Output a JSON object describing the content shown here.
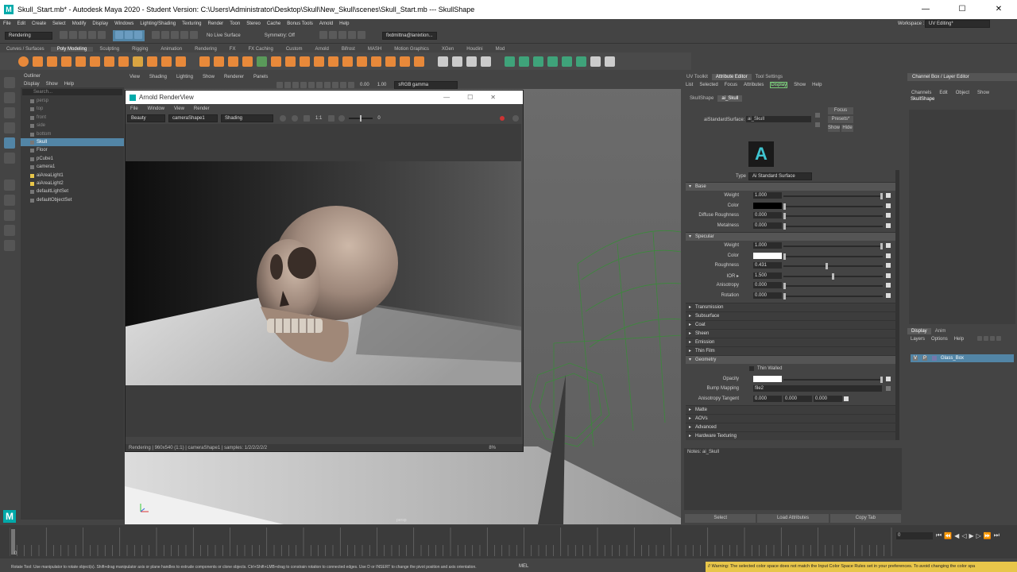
{
  "window": {
    "title": "Skull_Start.mb* - Autodesk Maya 2020 - Student Version: C:\\Users\\Administrator\\Desktop\\Skull\\New_Skull\\scenes\\Skull_Start.mb  ---  SkullShape",
    "logo": "M",
    "minimize": "—",
    "maximize": "☐",
    "close": "✕"
  },
  "menubar": {
    "items": [
      "File",
      "Edit",
      "Create",
      "Select",
      "Modify",
      "Display",
      "Windows",
      "Lighting/Shading",
      "Texturing",
      "Render",
      "Toon",
      "Stereo",
      "Cache",
      "Bonus Tools",
      "Arnold",
      "Help"
    ],
    "workspace_label": "Workspace :",
    "workspace_value": "UV Editing*"
  },
  "status": {
    "mode": "Rendering",
    "no_live_surface": "No Live Surface",
    "symmetry": "Symmetry: Off",
    "user": "fixdmittna@lanixtion..."
  },
  "shelf": {
    "tabs": [
      "Curves / Surfaces",
      "Poly Modeling",
      "Sculpting",
      "Rigging",
      "Animation",
      "Rendering",
      "FX",
      "FX Caching",
      "Custom",
      "Arnold",
      "Bifrost",
      "MASH",
      "Motion Graphics",
      "XGen",
      "Houdini",
      "Mod"
    ],
    "active_tab": "Poly Modeling"
  },
  "outliner": {
    "title": "Outliner",
    "menu": [
      "Display",
      "Show",
      "Help"
    ],
    "search_placeholder": "Search...",
    "items": [
      {
        "label": "persp",
        "state": "dim"
      },
      {
        "label": "top",
        "state": "dim"
      },
      {
        "label": "front",
        "state": "dim"
      },
      {
        "label": "side",
        "state": "dim"
      },
      {
        "label": "bottom",
        "state": "dim"
      },
      {
        "label": "Skull",
        "state": "sel"
      },
      {
        "label": "Floor",
        "state": ""
      },
      {
        "label": "pCube1",
        "state": ""
      },
      {
        "label": "camera1",
        "state": ""
      },
      {
        "label": "aiAreaLight1",
        "state": ""
      },
      {
        "label": "aiAreaLight2",
        "state": ""
      },
      {
        "label": "defaultLightSet",
        "state": ""
      },
      {
        "label": "defaultObjectSet",
        "state": ""
      }
    ]
  },
  "viewport": {
    "menu": [
      "View",
      "Shading",
      "Lighting",
      "Show",
      "Renderer",
      "Panels"
    ],
    "value_a": "0.00",
    "value_b": "1.00",
    "colorspace": "sRGB gamma",
    "camera_label": "persp"
  },
  "render_view": {
    "title": "Arnold RenderView",
    "menu": [
      "File",
      "Window",
      "View",
      "Render"
    ],
    "aov": "Beauty",
    "camera": "cameraShape1",
    "shading": "Shading",
    "ratio": "1:1",
    "exposure": "0",
    "status": "Rendering | 960x540 (1:1) | cameraShape1 | samples: 1/2/2/2/2/2",
    "progress": "8%"
  },
  "attribute_editor": {
    "tabs": [
      "UV Toolkit",
      "Attribute Editor",
      "Tool Settings"
    ],
    "active_tab": "Attribute Editor",
    "menu": [
      "List",
      "Selected",
      "Focus",
      "Attributes",
      "Display",
      "Show",
      "Help"
    ],
    "node_tabs": [
      "SkullShape",
      "ai_Skull"
    ],
    "active_node": "ai_Skull",
    "shader_label": "aiStandardSurface:",
    "shader_name": "ai_Skull",
    "focus": "Focus",
    "presets": "Presets*",
    "show": "Show",
    "hide": "Hide",
    "logo_letter": "A",
    "type_label": "Type",
    "type_value": "Ai Standard Surface",
    "base": {
      "title": "Base",
      "rows": [
        {
          "label": "Weight",
          "value": "1.000",
          "level": 1.0
        },
        {
          "label": "Color",
          "value": "",
          "swatch": "#000000",
          "level": 0.0
        },
        {
          "label": "Diffuse Roughness",
          "value": "0.000",
          "level": 0.0
        },
        {
          "label": "Metalness",
          "value": "0.000",
          "level": 0.0
        }
      ]
    },
    "specular": {
      "title": "Specular",
      "rows": [
        {
          "label": "Weight",
          "value": "1.000",
          "level": 1.0
        },
        {
          "label": "Color",
          "value": "",
          "swatch": "#ffffff",
          "level": 0.0
        },
        {
          "label": "Roughness",
          "value": "0.431",
          "level": 0.431
        },
        {
          "label": "IOR ▸",
          "value": "1.500",
          "level": 0.5
        },
        {
          "label": "Anisotropy",
          "value": "0.000",
          "level": 0.0
        },
        {
          "label": "Rotation",
          "value": "0.000",
          "level": 0.0
        }
      ]
    },
    "closed_sections": [
      "Transmission",
      "Subsurface",
      "Coat",
      "Sheen",
      "Emission",
      "Thin Film"
    ],
    "geometry": {
      "title": "Geometry",
      "thin_walled": "Thin Walled",
      "opacity_label": "Opacity",
      "bump_label": "Bump Mapping",
      "bump_value": "file2",
      "aniso_label": "Anisotropy Tangent",
      "aniso_values": [
        "0.000",
        "0.000",
        "0.000"
      ]
    },
    "more_sections": [
      "Matte",
      "AOVs",
      "Advanced",
      "Hardware Texturing"
    ],
    "notes": "Notes:  ai_Skull",
    "buttons": [
      "Select",
      "Load Attributes",
      "Copy Tab"
    ]
  },
  "channel_box": {
    "title": "Channel Box / Layer Editor",
    "menu": [
      "Channels",
      "Edit",
      "Object",
      "Show"
    ],
    "object": "SkullShape",
    "layer_tabs": [
      "Display",
      "Anim"
    ],
    "layer_menu": [
      "Layers",
      "Options",
      "Help"
    ],
    "layer_name": "Glass_Box",
    "v": "V",
    "p": "P"
  },
  "timeline": {
    "start": "0",
    "current": "0"
  },
  "helpline": {
    "text": "Rotate Tool: Use manipulator to rotate object(s). Shift+drag manipulator axis or plane handles to extrude components or clone objects. Ctrl+Shift+LMB+drag to constrain rotation to connected edges. Use D or INSERT to change the pivot position and axis orientation.",
    "mel": "MEL",
    "warning": "// Warning: The selected color space does not match the Input Color Space Rules set in your preferences. To avoid changing the color spa"
  }
}
